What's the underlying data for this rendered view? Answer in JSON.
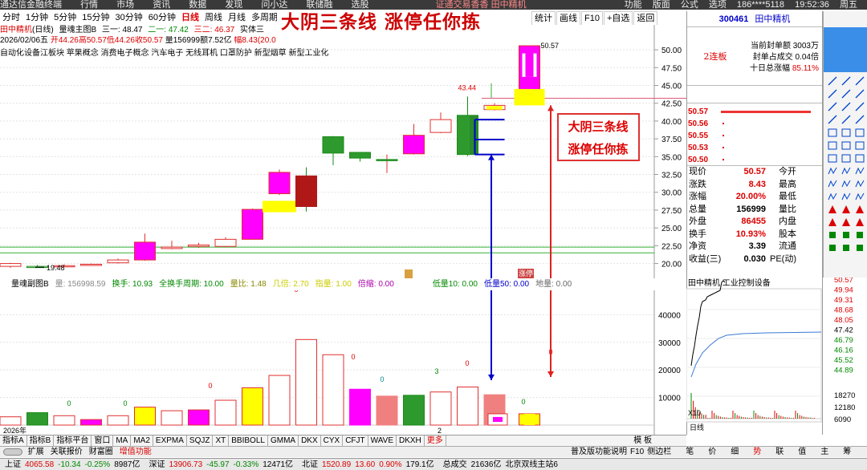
{
  "menu": {
    "items": [
      "通达信金融终端",
      "行情",
      "市场",
      "资讯",
      "数据",
      "发现",
      "问小达",
      "联储融",
      "选股"
    ],
    "right": [
      "功能",
      "版面",
      "公式",
      "选项",
      "186****5118",
      "19:52:36",
      "周五"
    ],
    "mid_tag": "证通交易香香 田中精机"
  },
  "timeframes": [
    "分时",
    "1分钟",
    "5分钟",
    "15分钟",
    "30分钟",
    "60分钟",
    "日线",
    "周线",
    "月线",
    "多周期",
    "更"
  ],
  "active_timeframe": "日线",
  "right_toolbar": [
    "统计",
    "画线",
    "F10",
    "+自选",
    "返回"
  ],
  "headline": "大阴三条线 涨停任你拣",
  "stock": {
    "name": "田中精机",
    "period": "(日线)",
    "code": "300461"
  },
  "main_indicator": {
    "name": "量魂主图B",
    "v1": "三一: 48.47",
    "v2": "二一: 47.42",
    "v3": "三二: 46.37",
    "v4": "实体三"
  },
  "bar_info": {
    "date": "2026/02/06五",
    "open": "开44.26",
    "high": "高50.57",
    "low": "低44.26",
    "close": "收50.57",
    "volume": "量156999",
    "amount": "额7.52亿",
    "amplitude": "幅8.43(20.0"
  },
  "concepts": "自动化设备江板块 苹果概念 消费电子概念 汽车电子 无线耳机 口罩防护 新型烟草 新型工业化",
  "chart_data": [
    {
      "type": "candlestick",
      "title": "田中精机(日线)",
      "y_ticks": [
        20,
        22.5,
        25,
        27.5,
        30,
        32.5,
        35,
        37.5,
        40,
        42.5,
        45,
        47.5,
        50
      ],
      "ylim": [
        18.6,
        53.5
      ],
      "candles": [
        {
          "o": 19.6,
          "c": 20.0,
          "h": 20.1,
          "l": 19.4
        },
        {
          "o": 19.6,
          "c": 19.5,
          "h": 19.8,
          "l": 19.48
        },
        {
          "o": 19.6,
          "c": 19.7,
          "h": 19.9,
          "l": 19.5
        },
        {
          "o": 19.8,
          "c": 19.9,
          "h": 20.0,
          "l": 19.7
        },
        {
          "o": 20.1,
          "c": 20.5,
          "h": 20.7,
          "l": 20.0
        },
        {
          "o": 20.5,
          "c": 23.0,
          "h": 24.2,
          "l": 20.4
        },
        {
          "o": 22.1,
          "c": 22.3,
          "h": 23.2,
          "l": 22.0
        },
        {
          "o": 22.4,
          "c": 22.6,
          "h": 22.9,
          "l": 22.2
        },
        {
          "o": 22.4,
          "c": 23.4,
          "h": 23.7,
          "l": 22.3
        },
        {
          "o": 23.4,
          "c": 27.6,
          "h": 27.7,
          "l": 23.4
        },
        {
          "o": 29.8,
          "c": 32.8,
          "h": 33.2,
          "l": 29.6
        },
        {
          "o": 32.3,
          "c": 28.0,
          "h": 33.5,
          "l": 27.3
        },
        {
          "o": 37.8,
          "c": 35.5,
          "h": 37.9,
          "l": 33.8
        },
        {
          "o": 35.6,
          "c": 34.8,
          "h": 35.6,
          "l": 34.3
        },
        {
          "o": 34.6,
          "c": 34.6,
          "h": 35.3,
          "l": 32.7
        },
        {
          "o": 35.4,
          "c": 38.0,
          "h": 39.6,
          "l": 35.3
        },
        {
          "o": 38.4,
          "c": 40.2,
          "h": 41.2,
          "l": 38.3
        },
        {
          "o": 40.8,
          "c": 35.3,
          "h": 43.44,
          "l": 35.1
        },
        {
          "o": 41.6,
          "c": 42.2,
          "h": 42.5,
          "l": 41.5
        },
        {
          "o": 44.26,
          "c": 50.57,
          "h": 50.57,
          "l": 44.26
        }
      ],
      "label_high": "50.57",
      "label_mid": "43.44",
      "label_low": "19.48"
    },
    {
      "type": "bar",
      "title": "量魂副图B",
      "y_ticks": [
        10000,
        20000,
        30000,
        40000
      ],
      "ylim": [
        0,
        46500
      ],
      "volumes": [
        3000,
        4500,
        3400,
        2000,
        3400,
        6500,
        5200,
        5500,
        9000,
        13500,
        18000,
        31000,
        25500,
        13000,
        10500,
        10800,
        12000,
        13800,
        11000,
        4100,
        4100
      ]
    }
  ],
  "sub_indicator": {
    "label": "量魂副图B",
    "vol": "量: 156998.59",
    "swap": "换手: 10.93",
    "fullswap": "全换手周期: 10.00",
    "ratio": "量比: 1.48",
    "v4": "几倍: 2.70",
    "v5": "指量: 1.00",
    "v6": "倍缩: 0.00",
    "v7": "低量10: 0.00",
    "v8": "低量50: 0.00",
    "v9": "地量: 0.00"
  },
  "sub_marks": [
    "0",
    "0",
    "0",
    "0",
    "0",
    "3",
    "0",
    "0",
    "0",
    "0"
  ],
  "annotation": {
    "line1": "大阴三条线",
    "line2": "涨停任你拣"
  },
  "zt_tag": "涨停",
  "year_label": "2026年",
  "right_panel": {
    "lianban": "2连板",
    "order_info": [
      {
        "k": "当前封单额",
        "v": "3003万"
      },
      {
        "k": "封单占成交",
        "v": "0.04倍"
      },
      {
        "k": "十日总涨幅",
        "v": "85.11%"
      }
    ],
    "sells": [
      {
        "p": "50.57",
        "dot": true
      },
      {
        "p": "50.56",
        "dot": true
      },
      {
        "p": "50.55",
        "dot": true
      },
      {
        "p": "50.53",
        "dot": true
      },
      {
        "p": "50.50",
        "dot": true
      }
    ],
    "quote": [
      {
        "l1": "现价",
        "v1": "50.57",
        "c1": "up",
        "l2": "今开",
        "v2": "",
        "c2": "up"
      },
      {
        "l1": "涨跌",
        "v1": "8.43",
        "c1": "up",
        "l2": "最高",
        "v2": "",
        "c2": "up"
      },
      {
        "l1": "涨幅",
        "v1": "20.00%",
        "c1": "up",
        "l2": "最低",
        "v2": "",
        "c2": "up"
      },
      {
        "l1": "总量",
        "v1": "156999",
        "c1": "",
        "l2": "量比",
        "v2": "",
        "c2": ""
      },
      {
        "l1": "外盘",
        "v1": "86455",
        "c1": "up",
        "l2": "内盘",
        "v2": "",
        "c2": "dn"
      },
      {
        "l1": "换手",
        "v1": "10.93%",
        "c1": "up",
        "l2": "股本",
        "v2": "",
        "c2": ""
      },
      {
        "l1": "净资",
        "v1": "3.39",
        "c1": "",
        "l2": "流通",
        "v2": "",
        "c2": ""
      },
      {
        "l1": "收益(三)",
        "v1": "0.030",
        "c1": "",
        "l2": "PE(动)",
        "v2": "",
        "c2": ""
      }
    ],
    "tline_title": "田中精机  工业控制设备",
    "tline_y_left": [
      "40000",
      "30000",
      "20000",
      "10000"
    ],
    "tline_y_right": [
      "50.57",
      "49.94",
      "49.31",
      "48.68",
      "48.05",
      "47.42",
      "46.79",
      "46.16",
      "45.52",
      "44.89",
      "18270",
      "12180",
      "6090"
    ],
    "tline_x10": "X10",
    "tline_tab": "日线"
  },
  "tab_bar": [
    "指标A",
    "指标B",
    "指标平台",
    "窗口",
    "MA",
    "MA2",
    "EXPMA",
    "SQJZ",
    "XT",
    "BBIBOLL",
    "GMMA",
    "DKX",
    "CYX",
    "CFJT",
    "WAVE",
    "DKXH",
    "更多"
  ],
  "tab_right": "模 板",
  "btn_bar": [
    "扩展",
    "关联报价",
    "财富圈",
    "增值功能"
  ],
  "btn_bar_right": [
    "普及版功能说明",
    "F10",
    "侧边栏",
    "笔",
    "价",
    "细",
    "势",
    "联",
    "值",
    "主",
    "筹"
  ],
  "status": [
    {
      "t": "上证",
      "c": ""
    },
    {
      "t": "4065.58",
      "c": "up"
    },
    {
      "t": "-10.34",
      "c": "dn"
    },
    {
      "t": "-0.25%",
      "c": "dn"
    },
    {
      "t": "8987亿",
      "c": ""
    },
    {
      "t": "深证",
      "c": ""
    },
    {
      "t": "13906.73",
      "c": "up"
    },
    {
      "t": "-45.97",
      "c": "dn"
    },
    {
      "t": "-0.33%",
      "c": "dn"
    },
    {
      "t": "12471亿",
      "c": ""
    },
    {
      "t": "北证",
      "c": ""
    },
    {
      "t": "1520.89",
      "c": "up"
    },
    {
      "t": "13.60",
      "c": "up"
    },
    {
      "t": "0.90%",
      "c": "up"
    },
    {
      "t": "179.1亿",
      "c": ""
    },
    {
      "t": "总成交",
      "c": ""
    },
    {
      "t": "21636亿",
      "c": ""
    },
    {
      "t": "北京双线主站6",
      "c": ""
    }
  ],
  "colors": {
    "up": "#dd0000",
    "down": "#008800",
    "magenta": "#ff00ff",
    "yellow": "#ffff00",
    "green": "#33a033",
    "blue": "#0000cc",
    "salmon": "#f08080"
  }
}
